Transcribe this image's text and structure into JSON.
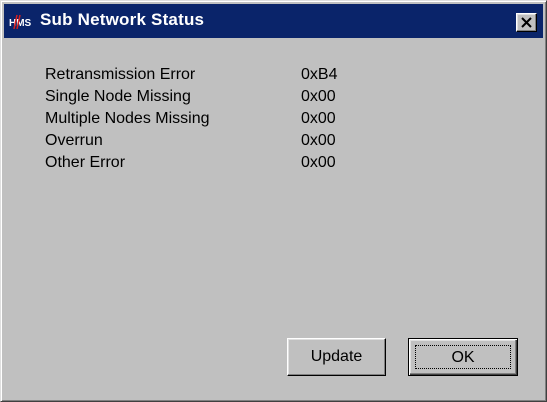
{
  "window": {
    "title": "Sub Network Status",
    "app_icon_text": "HMS",
    "close_label": "Close"
  },
  "status": {
    "items": [
      {
        "label": "Retransmission Error",
        "value": "0xB4"
      },
      {
        "label": "Single Node Missing",
        "value": "0x00"
      },
      {
        "label": "Multiple Nodes Missing",
        "value": "0x00"
      },
      {
        "label": "Overrun",
        "value": "0x00"
      },
      {
        "label": "Other Error",
        "value": "0x00"
      }
    ]
  },
  "buttons": {
    "update_label": "Update",
    "ok_label": "OK"
  },
  "colors": {
    "titlebar": "#0a246a",
    "face": "#c0c0c0",
    "logo_accent": "#d62020"
  },
  "icons": {
    "app": "hms-logo-icon",
    "close": "close-x-icon"
  }
}
